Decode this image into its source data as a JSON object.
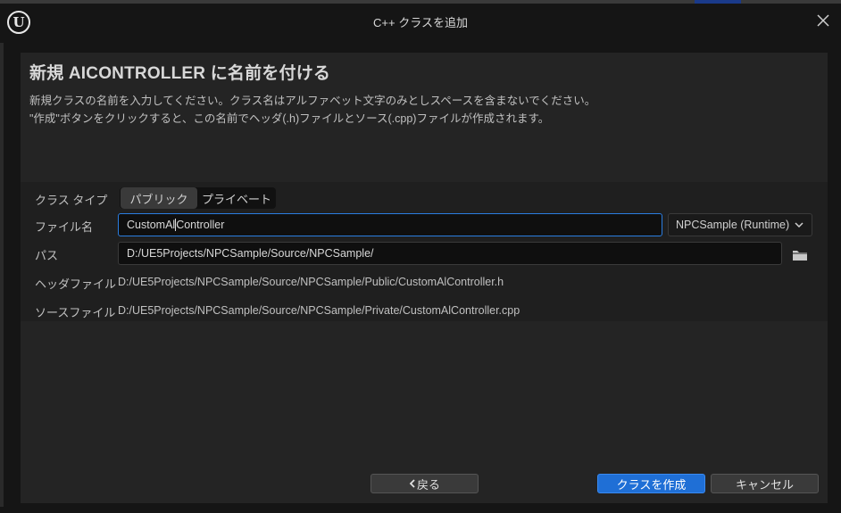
{
  "window": {
    "title": "C++ クラスを追加"
  },
  "heading": "新規 AICONTROLLER に名前を付ける",
  "description": {
    "line1": "新規クラスの名前を入力してください。クラス名はアルファベット文字のみとしスペースを含まないでください。",
    "line2": "\"作成\"ボタンをクリックすると、この名前でヘッダ(.h)ファイルとソース(.cpp)ファイルが作成されます。"
  },
  "form": {
    "class_type": {
      "label": "クラス タイプ",
      "options": [
        "パブリック",
        "プライベート"
      ],
      "selected": "パブリック"
    },
    "file_name": {
      "label": "ファイル名",
      "value_before_caret": "CustomAl",
      "value_after_caret": "Controller"
    },
    "module": {
      "selected": "NPCSample (Runtime)"
    },
    "path": {
      "label": "パス",
      "value": "D:/UE5Projects/NPCSample/Source/NPCSample/"
    },
    "header_file": {
      "label": "ヘッダファイル",
      "value": "D:/UE5Projects/NPCSample/Source/NPCSample/Public/CustomAlController.h"
    },
    "source_file": {
      "label": "ソースファイル",
      "value": "D:/UE5Projects/NPCSample/Source/NPCSample/Private/CustomAlController.cpp"
    }
  },
  "buttons": {
    "back": "戻る",
    "create": "クラスを作成",
    "cancel": "キャンセル"
  },
  "colors": {
    "accent": "#1f6fd6",
    "focus_border": "#2a7de0",
    "panel": "#242424",
    "background": "#151515"
  },
  "icons": {
    "logo": "unreal-logo-icon",
    "close": "close-icon",
    "dropdown": "chevron-down-icon",
    "browse": "folder-icon",
    "back": "chevron-left-icon"
  }
}
